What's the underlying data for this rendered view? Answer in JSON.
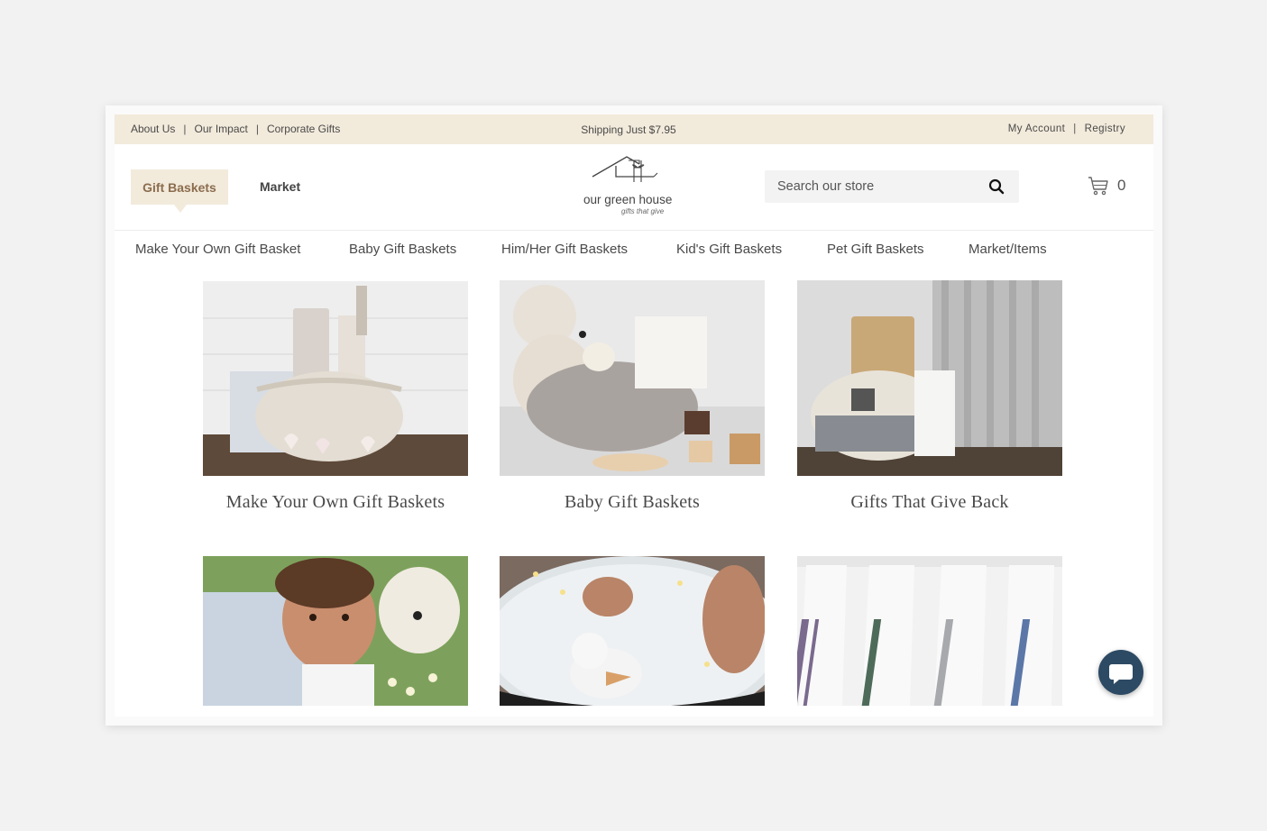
{
  "topbar": {
    "left_links": [
      "About Us",
      "Our Impact",
      "Corporate Gifts"
    ],
    "separator": "|",
    "shipping": "Shipping Just $7.95",
    "my_account": "My Account",
    "registry": "Registry"
  },
  "header": {
    "tab_gift_baskets": "Gift Baskets",
    "tab_market": "Market",
    "logo_name": "our green house",
    "logo_tagline": "gifts that give",
    "search_placeholder": "Search our store",
    "cart_count": "0"
  },
  "nav": [
    "Make Your Own Gift Basket",
    "Baby Gift Baskets",
    "Him/Her Gift Baskets",
    "Kid's Gift Baskets",
    "Pet Gift Baskets",
    "Market/Items"
  ],
  "cards": [
    {
      "caption": "Make Your Own Gift Baskets"
    },
    {
      "caption": "Baby Gift Baskets"
    },
    {
      "caption": "Gifts That Give Back"
    }
  ],
  "colors": {
    "accent_bg": "#f2eadb",
    "accent_text": "#8b6d4e",
    "chat": "#2d4a64"
  }
}
